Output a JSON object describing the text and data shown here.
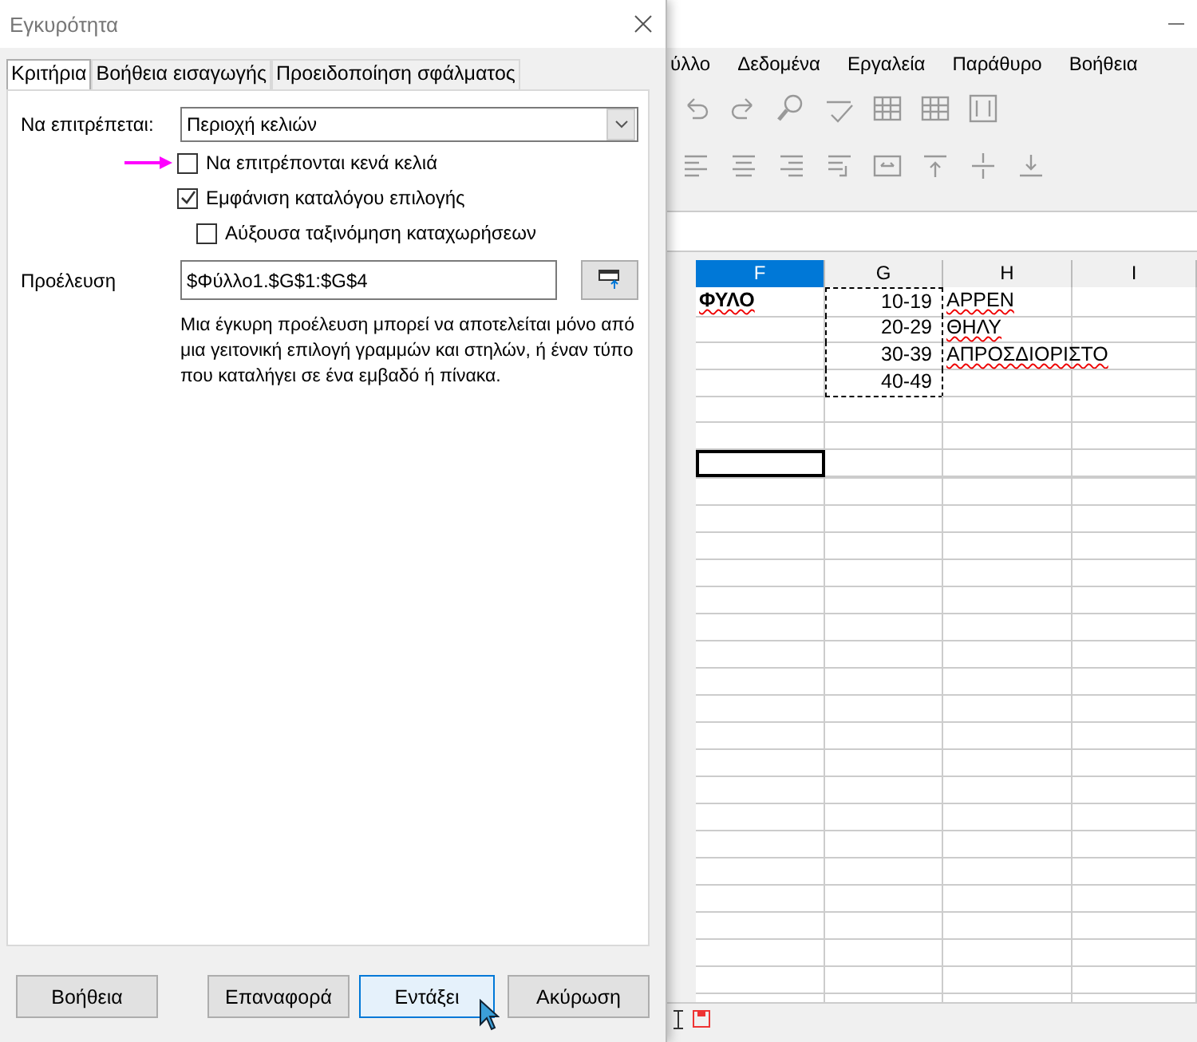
{
  "dialog": {
    "title": "Εγκυρότητα",
    "tabs": [
      {
        "label": "Κριτήρια",
        "selected": true
      },
      {
        "label": "Βοήθεια εισαγωγής",
        "selected": false
      },
      {
        "label": "Προειδοποίηση σφάλματος",
        "selected": false
      }
    ],
    "allow": {
      "label": "Να επιτρέπεται:",
      "value": "Περιοχή κελιών"
    },
    "options": [
      {
        "label": "Να επιτρέπονται κενά κελιά",
        "checked": false,
        "highlighted": true
      },
      {
        "label": "Εμφάνιση καταλόγου επιλογής",
        "checked": true,
        "highlighted": false,
        "children": [
          {
            "label": "Αύξουσα ταξινόμηση καταχωρήσεων",
            "checked": false,
            "highlighted": false
          }
        ]
      }
    ],
    "source": {
      "label": "Προέλευση",
      "value": "$Φύλλο1.$G$1:$G$4"
    },
    "hint": "Μια έγκυρη προέλευση μπορεί να αποτελείται μόνο από μια γειτονική επιλογή γραμμών και στηλών, ή έναν τύπο που καταλήγει σε ένα εμβαδό ή πίνακα.",
    "buttons": [
      {
        "label": "Βοήθεια",
        "default": false,
        "hovered": false
      },
      {
        "label": "Επαναφορά",
        "default": false,
        "hovered": false
      },
      {
        "label": "Εντάξει",
        "default": true,
        "hovered": true
      },
      {
        "label": "Ακύρωση",
        "default": false,
        "hovered": false
      }
    ]
  },
  "spreadsheet": {
    "menu": [
      "ύλλο",
      "Δεδομένα",
      "Εργαλεία",
      "Παράθυρο",
      "Βοήθεια"
    ],
    "columns": [
      {
        "label": "F",
        "selected": true
      },
      {
        "label": "G",
        "selected": false
      },
      {
        "label": "H",
        "selected": false
      },
      {
        "label": "I",
        "selected": false
      }
    ],
    "rows": [
      {
        "cells": [
          {
            "text": "ΦΥΛΟ",
            "bold": true,
            "kind": "text",
            "misspelled": true
          },
          {
            "text": "10-19",
            "kind": "number",
            "copied": true
          },
          {
            "text": "ΑΡΡΕΝ",
            "kind": "text",
            "misspelled": true
          },
          null
        ]
      },
      {
        "cells": [
          null,
          {
            "text": "20-29",
            "kind": "number",
            "copied": true
          },
          {
            "text": "ΘΗΛΥ",
            "kind": "text",
            "misspelled": true
          },
          null
        ]
      },
      {
        "cells": [
          null,
          {
            "text": "30-39",
            "kind": "number",
            "copied": true
          },
          {
            "text": "ΑΠΡΟΣΔΙΟΡΙΣΤΟ",
            "kind": "text",
            "misspelled": true
          },
          null
        ]
      },
      {
        "cells": [
          null,
          {
            "text": "40-49",
            "kind": "number",
            "copied": true
          },
          null,
          null
        ]
      },
      {
        "cells": [
          null,
          null,
          null,
          null
        ]
      },
      {
        "cells": [
          null,
          null,
          null,
          null
        ]
      },
      {
        "cells": [
          {
            "selected": true
          },
          null,
          null,
          null
        ]
      }
    ]
  }
}
